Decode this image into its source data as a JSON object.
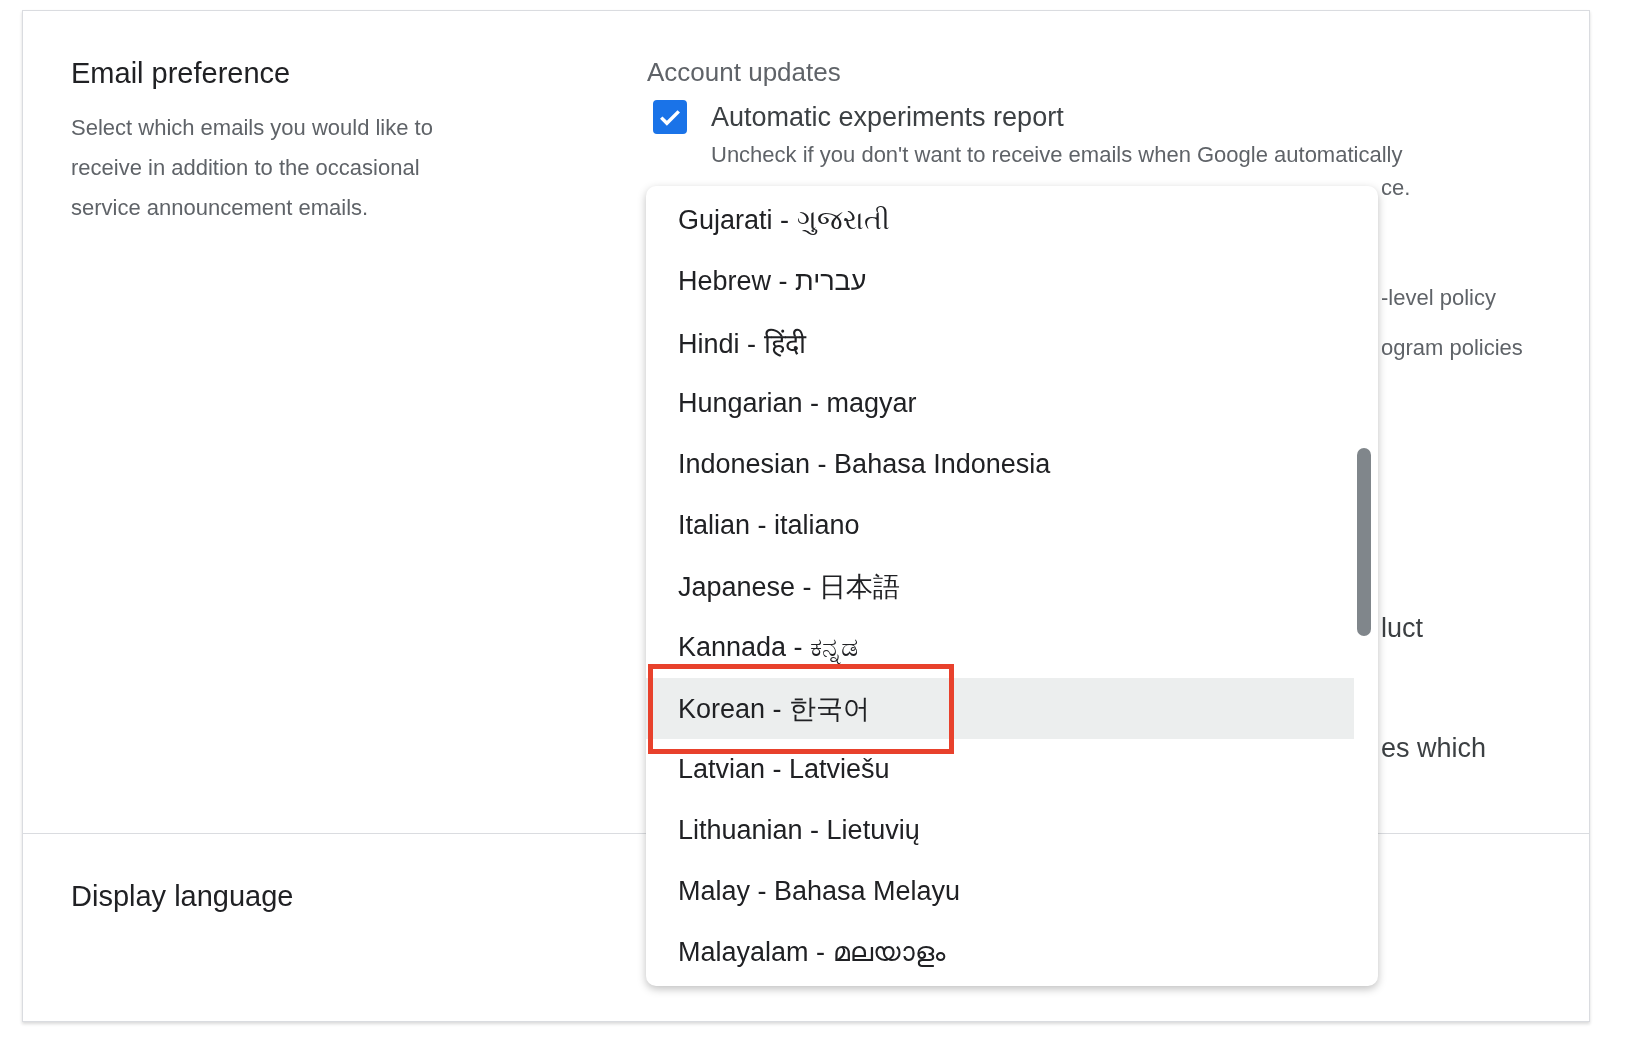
{
  "email_preference": {
    "title": "Email preference",
    "description": "Select which emails you would like to receive in addition to the occasional service announcement emails."
  },
  "account_updates": {
    "heading": "Account updates",
    "option": {
      "label": "Automatic experiments report",
      "checked": true,
      "description": "Uncheck if you don't want to receive emails when Google automatically"
    },
    "covered_fragments": [
      {
        "text": "ce.",
        "kind": "muted"
      },
      {
        "text": "-level policy",
        "kind": "muted"
      },
      {
        "text": "ogram policies",
        "kind": "muted"
      },
      {
        "text": "luct",
        "kind": "body"
      },
      {
        "text": "es which",
        "kind": "body"
      }
    ]
  },
  "display_language": {
    "title": "Display language"
  },
  "language_menu": {
    "items": [
      {
        "label": "Gujarati - ગુજરાતી",
        "selected": false
      },
      {
        "label": "Hebrew - עברית",
        "selected": false
      },
      {
        "label": "Hindi - हिंदी",
        "selected": false
      },
      {
        "label": "Hungarian - magyar",
        "selected": false
      },
      {
        "label": "Indonesian - Bahasa Indonesia",
        "selected": false
      },
      {
        "label": "Italian - italiano",
        "selected": false
      },
      {
        "label": "Japanese - 日本語",
        "selected": false
      },
      {
        "label": "Kannada - ಕನ್ನಡ",
        "selected": false
      },
      {
        "label": "Korean - 한국어",
        "selected": true,
        "highlighted": true
      },
      {
        "label": "Latvian - Latviešu",
        "selected": false
      },
      {
        "label": "Lithuanian - Lietuvių",
        "selected": false
      },
      {
        "label": "Malay - Bahasa Melayu",
        "selected": false
      },
      {
        "label": "Malayalam - മലയാളം",
        "selected": false
      }
    ]
  }
}
